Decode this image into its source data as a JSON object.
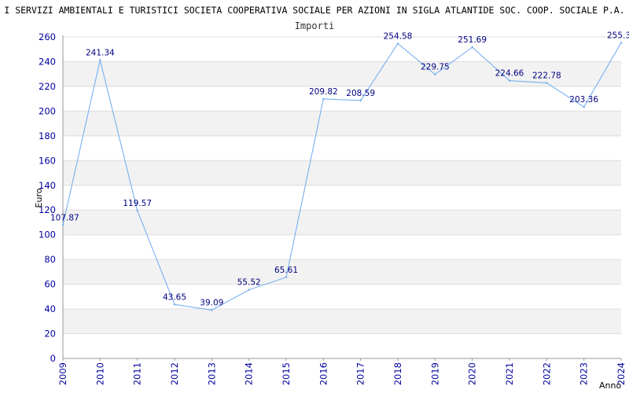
{
  "chart_data": {
    "type": "line",
    "title": "I SERVIZI AMBIENTALI E TURISTICI SOCIETA COOPERATIVA SOCIALE PER AZIONI IN SIGLA ATLANTIDE SOC. COOP. SOCIALE P.A.",
    "subtitle": "Importi",
    "xlabel": "Anno",
    "ylabel": "Euro",
    "ylim": [
      0,
      260
    ],
    "y_ticks": [
      0,
      20,
      40,
      60,
      80,
      100,
      120,
      140,
      160,
      180,
      200,
      220,
      240,
      260
    ],
    "grid": true,
    "categories": [
      "2009",
      "2010",
      "2011",
      "2012",
      "2013",
      "2014",
      "2015",
      "2016",
      "2017",
      "2018",
      "2019",
      "2020",
      "2021",
      "2022",
      "2023",
      "2024"
    ],
    "series": [
      {
        "values": [
          107.87,
          241.34,
          119.57,
          43.65,
          39.09,
          55.52,
          65.61,
          209.82,
          208.59,
          254.58,
          229.75,
          251.69,
          224.66,
          222.78,
          203.36,
          255.3
        ],
        "labels": [
          "107.87",
          "241.34",
          "119.57",
          "43.65",
          "39.09",
          "55.52",
          "65.61",
          "209.82",
          "208.59",
          "254.58",
          "229.75",
          "251.69",
          "224.66",
          "222.78",
          "203.36",
          "255.3"
        ]
      }
    ],
    "colors": {
      "line": "#6aaaf0",
      "axis_text": "#0000a0",
      "label_text": "#000080",
      "band": "#f2f2f2",
      "grid": "#dddddd"
    }
  }
}
